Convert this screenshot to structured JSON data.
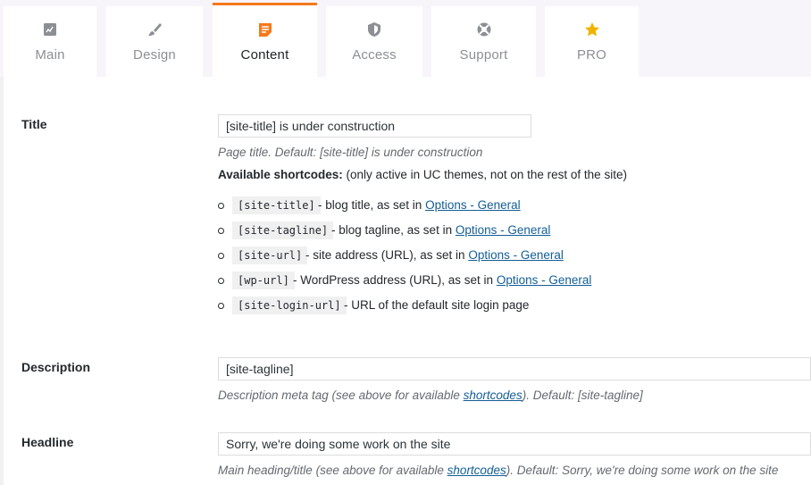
{
  "tabs": [
    {
      "label": "Main",
      "icon": "dashboard-icon",
      "active": false
    },
    {
      "label": "Design",
      "icon": "brush-icon",
      "active": false
    },
    {
      "label": "Content",
      "icon": "document-icon",
      "active": true
    },
    {
      "label": "Access",
      "icon": "shield-icon",
      "active": false
    },
    {
      "label": "Support",
      "icon": "lifebuoy-icon",
      "active": false
    },
    {
      "label": "PRO",
      "icon": "star-icon",
      "active": false
    }
  ],
  "accent_color": "#f5791c",
  "title_row": {
    "label": "Title",
    "value": "[site-title] is under construction",
    "description": "Page title. Default: [site-title] is under construction",
    "available_bold": "Available shortcodes:",
    "available_rest": " (only active in UC themes, not on the rest of the site)"
  },
  "shortcodes": [
    {
      "code": "[site-title]",
      "text": " - blog title, as set in ",
      "link": "Options - General"
    },
    {
      "code": "[site-tagline]",
      "text": " - blog tagline, as set in ",
      "link": "Options - General"
    },
    {
      "code": "[site-url]",
      "text": " - site address (URL), as set in ",
      "link": "Options - General"
    },
    {
      "code": "[wp-url]",
      "text": " - WordPress address (URL), as set in ",
      "link": "Options - General"
    },
    {
      "code": "[site-login-url]",
      "text": " - URL of the default site login page",
      "link": ""
    }
  ],
  "description_row": {
    "label": "Description",
    "value": "[site-tagline]",
    "desc_pre": "Description meta tag (see above for available ",
    "desc_link": "shortcodes",
    "desc_post": "). Default: [site-tagline]"
  },
  "headline_row": {
    "label": "Headline",
    "value": "Sorry, we're doing some work on the site",
    "desc_pre": "Main heading/title (see above for available ",
    "desc_link": "shortcodes",
    "desc_post": "). Default: Sorry, we're doing some work on the site"
  }
}
